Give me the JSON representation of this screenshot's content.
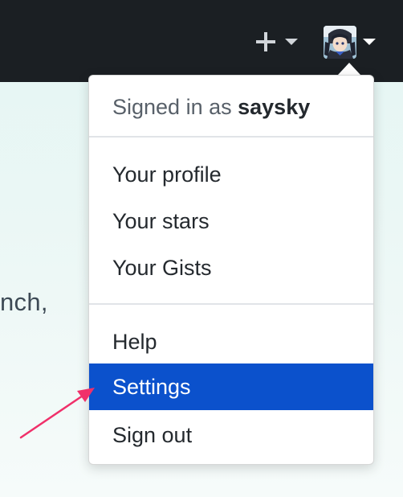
{
  "header": {
    "new_icon": "plus-icon",
    "new_caret_icon": "caret-down-icon",
    "avatar_caret_icon": "caret-down-icon",
    "bar_color": "#1b1f23"
  },
  "background": {
    "partial_text": "nch,"
  },
  "dropdown": {
    "signed_in_prefix": "Signed in as",
    "username": "saysky",
    "profile_items": [
      "Your profile",
      "Your stars",
      "Your Gists"
    ],
    "account_items": [
      "Help",
      "Settings",
      "Sign out"
    ],
    "active_item": "Settings",
    "active_color": "#0b51cc"
  },
  "annotation": {
    "arrow_color": "#f0306a"
  }
}
